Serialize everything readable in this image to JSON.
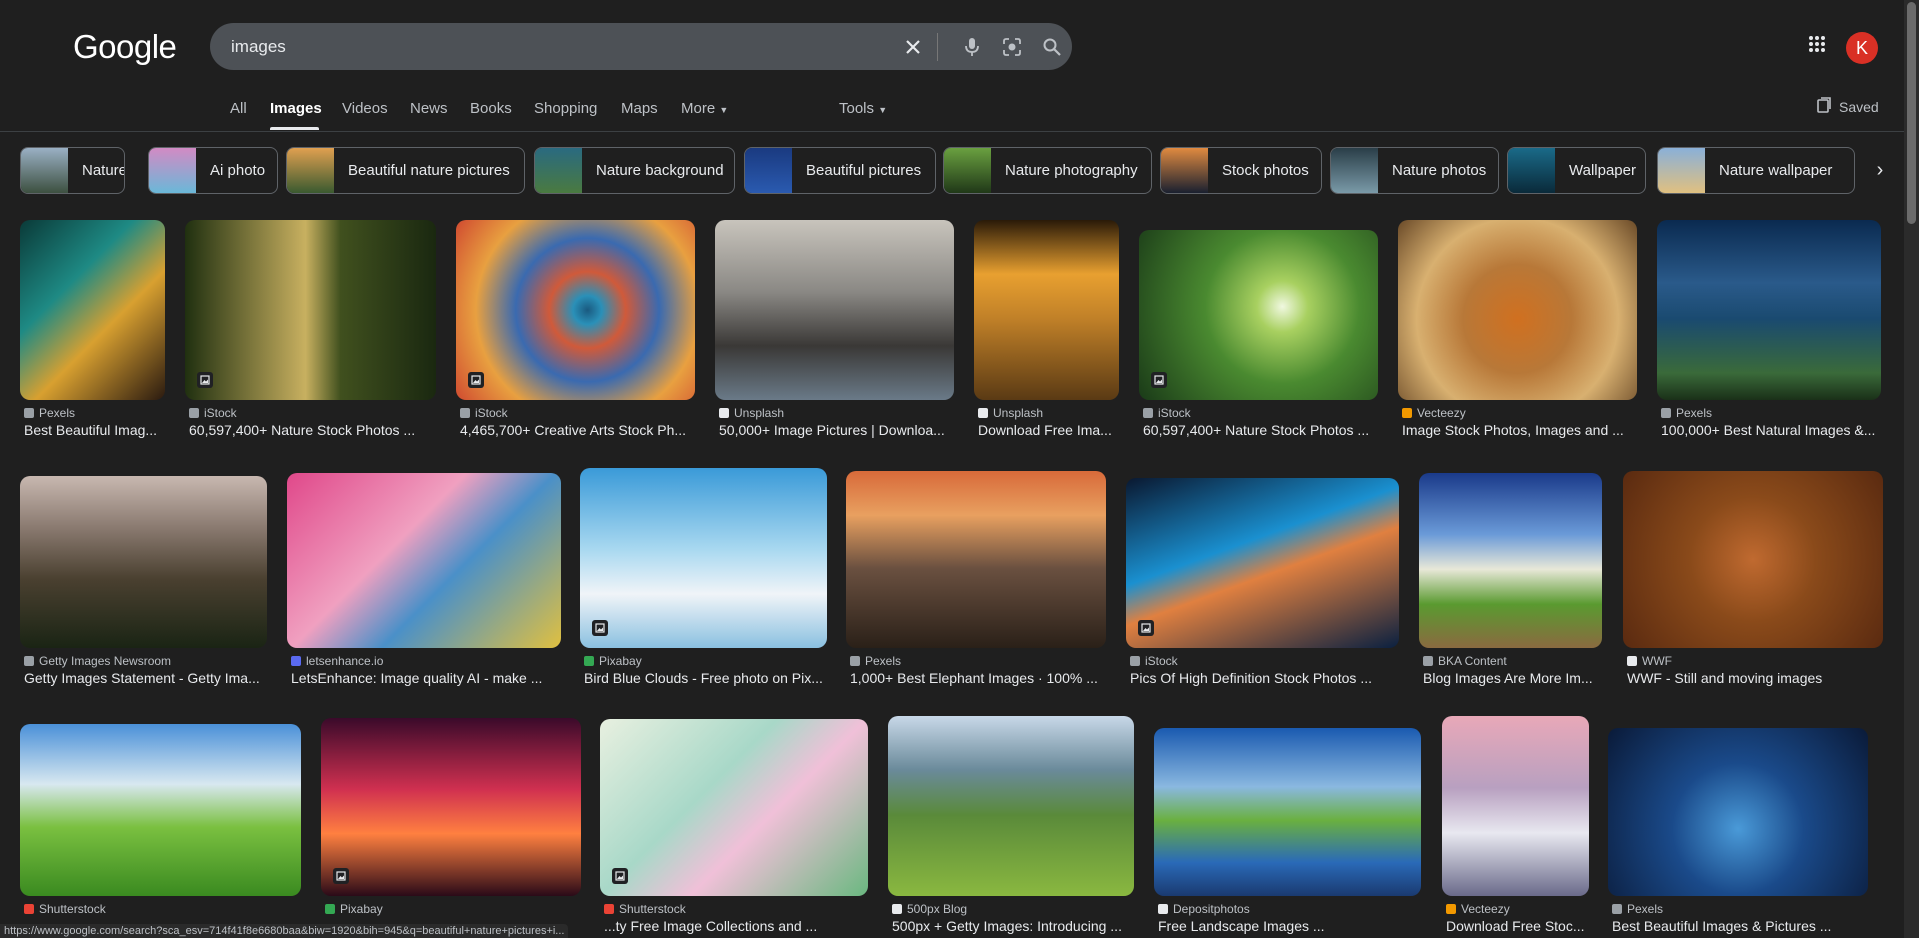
{
  "header": {
    "logo": "Google",
    "search_value": "images",
    "avatar_letter": "K"
  },
  "tabs": [
    {
      "label": "All"
    },
    {
      "label": "Images"
    },
    {
      "label": "Videos"
    },
    {
      "label": "News"
    },
    {
      "label": "Books"
    },
    {
      "label": "Shopping"
    },
    {
      "label": "Maps"
    },
    {
      "label": "More"
    },
    {
      "label": "Tools"
    }
  ],
  "saved_label": "Saved",
  "chips": [
    {
      "label": "Nature",
      "c1": "#9ab0c4",
      "c2": "#3d5040"
    },
    {
      "label": "Ai photo",
      "c1": "#d28ac4",
      "c2": "#6ab8d8"
    },
    {
      "label": "Beautiful nature pictures",
      "c1": "#e0a050",
      "c2": "#3a5a30"
    },
    {
      "label": "Nature background",
      "c1": "#2a6a80",
      "c2": "#4a7a40"
    },
    {
      "label": "Beautiful pictures",
      "c1": "#1a3a80",
      "c2": "#2a5ab0"
    },
    {
      "label": "Nature photography",
      "c1": "#6aa040",
      "c2": "#203818"
    },
    {
      "label": "Stock photos",
      "c1": "#e08a40",
      "c2": "#1a2030"
    },
    {
      "label": "Nature photos",
      "c1": "#2a3e48",
      "c2": "#7a9aa8"
    },
    {
      "label": "Wallpaper",
      "c1": "#1a6a88",
      "c2": "#0a2a3a"
    },
    {
      "label": "Nature wallpaper",
      "c1": "#8ab0d8",
      "c2": "#e0c080"
    }
  ],
  "results_row1": [
    {
      "source": "Pexels",
      "title": "Best Beautiful Imag...",
      "fav": "#9aa0a6",
      "bg": "linear-gradient(135deg,#0a3a38 0%,#1e8a84 35%,#d8a030 60%,#2a1a10 100%)"
    },
    {
      "source": "iStock",
      "title": "60,597,400+ Nature Stock Photos ...",
      "fav": "#9aa0a6",
      "bg": "linear-gradient(90deg,#203010 0%,#c8b060 48%,#40501e 62%,#1a2810 100%)"
    },
    {
      "source": "iStock",
      "title": "4,465,700+ Creative Arts Stock Ph...",
      "fav": "#9aa0a6",
      "bg": "radial-gradient(circle at 55% 50%,#1a5a80 0%,#2a90b8 9%,#d05a3a 24%,#3a6ab0 45%,#e8a040 70%,#d04a30 100%)"
    },
    {
      "source": "Unsplash",
      "title": "50,000+ Image Pictures | Downloa...",
      "fav": "#e8eaed",
      "bg": "linear-gradient(180deg,#c8c4bc 0%,#8a8884 40%,#3a3836 70%,#6a7a88 100%)"
    },
    {
      "source": "Unsplash",
      "title": "Download Free Ima...",
      "fav": "#e8eaed",
      "bg": "linear-gradient(180deg,#2a1a08 0%,#e8a030 30%,#c08028 55%,#5a3a14 100%)"
    },
    {
      "source": "iStock",
      "title": "60,597,400+ Nature Stock Photos ...",
      "fav": "#9aa0a6",
      "bg": "radial-gradient(circle at 60% 45%,#f0f8e0 0%,#a8d060 15%,#4a8a30 45%,#1a3a18 100%)"
    },
    {
      "source": "Vecteezy",
      "title": "Image Stock Photos, Images and ...",
      "fav": "#f29900",
      "bg": "radial-gradient(circle at 50% 55%,#d07020 0%,#b87838 35%,#d8b070 65%,#6a4a28 100%)"
    },
    {
      "source": "Pexels",
      "title": "100,000+ Best Natural Images &...",
      "fav": "#9aa0a6",
      "bg": "linear-gradient(180deg,#0a2a50 0%,#2a5a8a 35%,#1a4a70 55%,#3a6a3a 85%,#1a3018 100%)"
    }
  ],
  "results_row2": [
    {
      "source": "Getty Images Newsroom",
      "title": "Getty Images Statement - Getty Ima...",
      "fav": "#9aa0a6",
      "bg": "linear-gradient(180deg,#c8b8b0 0%,#8a7a70 30%,#4a4030 60%,#1a2414 100%)"
    },
    {
      "source": "letsenhance.io",
      "title": "LetsEnhance: Image quality AI - make ...",
      "fav": "#5a6af0",
      "bg": "linear-gradient(135deg,#e0488a 0%,#f0a0c0 40%,#4a90c8 60%,#e0c040 100%)"
    },
    {
      "source": "Pixabay",
      "title": "Bird Blue Clouds - Free photo on Pix...",
      "fav": "#34a853",
      "bg": "linear-gradient(180deg,#3a9ad8 0%,#a8d8f0 45%,#f0f4f8 70%,#8ac0e0 100%)"
    },
    {
      "source": "Pexels",
      "title": "1,000+ Best Elephant Images · 100% ...",
      "fav": "#9aa0a6",
      "bg": "linear-gradient(180deg,#d86a3a 0%,#e8a060 25%,#6a5040 55%,#2a2018 100%)"
    },
    {
      "source": "iStock",
      "title": "Pics Of High Definition Stock Photos ...",
      "fav": "#9aa0a6",
      "bg": "linear-gradient(160deg,#0a1830 0%,#1a90d0 40%,#e08040 55%,#0a2040 100%)"
    },
    {
      "source": "BKA Content",
      "title": "Blog Images Are More Im...",
      "fav": "#9aa0a6",
      "bg": "linear-gradient(180deg,#1a3a8a 0%,#6a9ad8 35%,#e8e8d8 55%,#5a9a30 75%,#8a6a40 100%)"
    },
    {
      "source": "WWF",
      "title": "WWF - Still and moving images",
      "fav": "#e8eaed",
      "bg": "radial-gradient(circle at 50% 50%,#c06a30 0%,#8a4a1a 40%,#5a2a10 100%)"
    }
  ],
  "results_row3": [
    {
      "source": "Shutterstock",
      "title": "",
      "fav": "#ea4335",
      "bg": "linear-gradient(180deg,#4a90d8 0%,#d8e8f0 35%,#7ac040 60%,#3a8a20 100%)"
    },
    {
      "source": "Pixabay",
      "title": "",
      "fav": "#34a853",
      "bg": "linear-gradient(180deg,#3a0a2a 0%,#d03050 40%,#ff8040 65%,#2a0a18 100%)"
    },
    {
      "source": "Shutterstock",
      "title": "...ty Free Image Collections and ...",
      "fav": "#ea4335",
      "bg": "linear-gradient(135deg,#e8f0e0 0%,#a8d8c8 40%,#f0c0d8 60%,#6ab880 100%)"
    },
    {
      "source": "500px Blog",
      "title": "500px + Getty Images: Introducing ...",
      "fav": "#e8eaed",
      "bg": "linear-gradient(180deg,#c8d8e8 0%,#6a8a9a 30%,#5a8a3a 55%,#8ab840 100%)"
    },
    {
      "source": "Depositphotos",
      "title": "Free Landscape Images ...",
      "fav": "#e8eaed",
      "bg": "linear-gradient(180deg,#1a5ab0 0%,#8ab8e0 35%,#6ab040 55%,#2a6ab8 80%,#1a3a70 100%)"
    },
    {
      "source": "Vecteezy",
      "title": "Download Free Stoc...",
      "fav": "#f29900",
      "bg": "linear-gradient(180deg,#e8a8b8 0%,#b8a0c0 40%,#e8e8f0 65%,#6a6a8a 100%)"
    },
    {
      "source": "Pexels",
      "title": "Best Beautiful Images & Pictures ...",
      "fav": "#9aa0a6",
      "bg": "radial-gradient(circle at 50% 60%,#4a9ad8 0%,#1a4a8a 40%,#0a1a38 100%)"
    }
  ],
  "status_url": "https://www.google.com/search?sca_esv=714f41f8e6680baa&biw=1920&bih=945&q=beautiful+nature+pictures+i..."
}
